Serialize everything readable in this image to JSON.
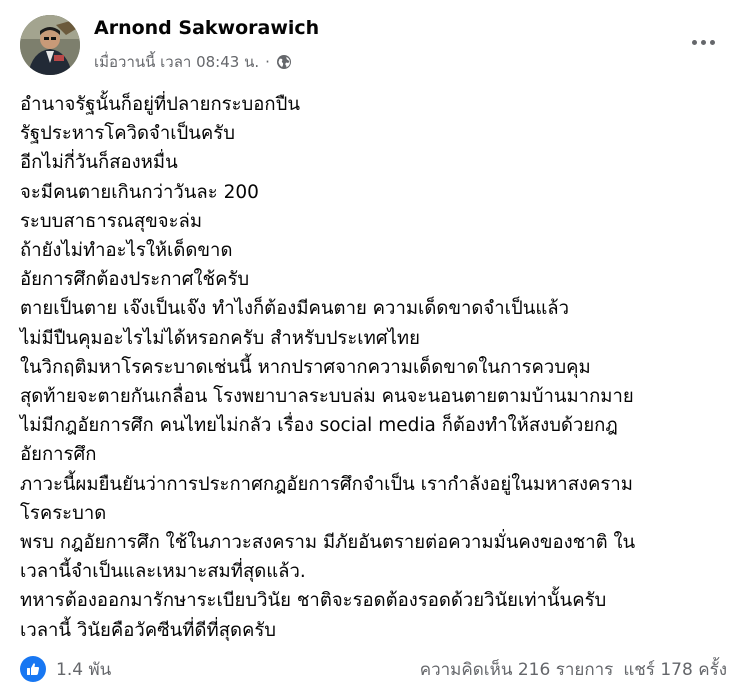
{
  "post": {
    "author": "Arnond Sakworawich",
    "timestamp": "เมื่อวานนี้ เวลา 08:43 น.",
    "separator": "·",
    "audience_icon": "globe-icon",
    "more_icon": "more-options-icon",
    "lines": [
      "อำนาจรัฐนั้นก็อยู่ที่ปลายกระบอกปืน",
      "รัฐประหารโควิดจำเป็นครับ",
      "อีกไม่กี่วันก็สองหมื่น",
      "จะมีคนตายเกินกว่าวันละ 200",
      "ระบบสาธารณสุขจะล่ม",
      "ถ้ายังไม่ทำอะไรให้เด็ดขาด",
      "อัยการศึกต้องประกาศใช้ครับ",
      "ตายเป็นตาย เจ๊งเป็นเจ๊ง ทำไงก็ต้องมีคนตาย ความเด็ดขาดจำเป็นแล้ว",
      "ไม่มีปืนคุมอะไรไม่ได้หรอกครับ สำหรับประเทศไทย",
      "ในวิกฤติมหาโรคระบาดเช่นนี้ หากปราศจากความเด็ดขาดในการควบคุม",
      "สุดท้ายจะตายกันเกลื่อน โรงพยาบาลระบบล่ม คนจะนอนตายตามบ้านมากมาย",
      "ไม่มีกฎอัยการศึก คนไทยไม่กลัว เรื่อง social media ก็ต้องทำให้สงบด้วยกฎ",
      "อัยการศึก",
      "ภาวะนี้ผมยืนยันว่าการประกาศกฎอัยการศึกจำเป็น เรากำลังอยู่ในมหาสงคราม",
      "โรคระบาด",
      "พรบ กฎอัยการศึก ใช้ในภาวะสงคราม มีภัยอันตรายต่อความมั่นคงของชาติ ใน",
      "เวลานี้จำเป็นและเหมาะสมที่สุดแล้ว.",
      "ทหารต้องออกมารักษาระเบียบวินัย ชาติจะรอดต้องรอดด้วยวินัยเท่านั้นครับ",
      "เวลานี้ วินัยคือวัคซีนที่ดีที่สุดครับ"
    ]
  },
  "footer": {
    "reaction_icon": "like-icon",
    "reactions": "1.4 พัน",
    "comments": "ความคิดเห็น 216 รายการ",
    "shares": "แชร์ 178 ครั้ง"
  },
  "colors": {
    "accent": "#1877f2",
    "secondary_text": "#65676b",
    "primary_text": "#050505"
  }
}
